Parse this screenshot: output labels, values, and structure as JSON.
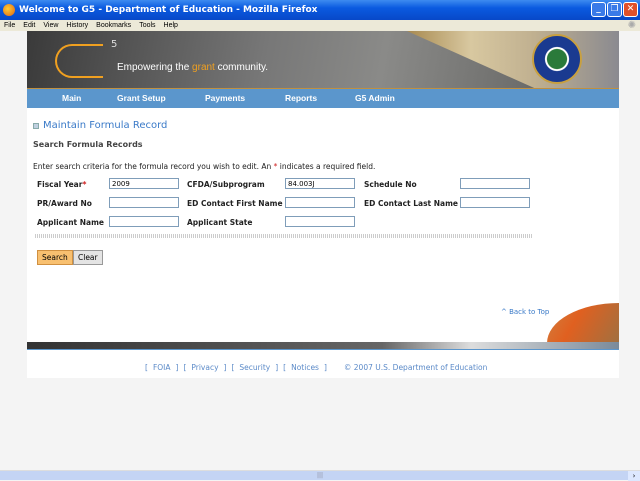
{
  "window": {
    "title": "Welcome to G5 - Department of Education - Mozilla Firefox"
  },
  "menu": [
    "File",
    "Edit",
    "View",
    "History",
    "Bookmarks",
    "Tools",
    "Help"
  ],
  "header": {
    "logo_super": "5",
    "tagline_pre": "Empowering the ",
    "tagline_hl": "grant",
    "tagline_post": " community."
  },
  "nav": [
    "Main",
    "Grant Setup",
    "Payments",
    "Reports",
    "G5 Admin"
  ],
  "page": {
    "title": "Maintain Formula Record",
    "subtitle": "Search Formula Records",
    "instr_pre": "Enter search criteria for the formula record you wish to edit. An ",
    "instr_star": "*",
    "instr_post": " indicates a required field."
  },
  "form": {
    "fiscal_year": {
      "label": "Fiscal Year",
      "star": "*",
      "value": "2009"
    },
    "cfda": {
      "label": "CFDA/Subprogram",
      "value": "84.003J"
    },
    "schedule": {
      "label": "Schedule No",
      "value": ""
    },
    "pr_award": {
      "label": "PR/Award No",
      "value": ""
    },
    "ed_first": {
      "label": "ED Contact First Name",
      "value": ""
    },
    "ed_last": {
      "label": "ED Contact Last Name",
      "value": ""
    },
    "applicant_name": {
      "label": "Applicant Name",
      "value": ""
    },
    "applicant_state": {
      "label": "Applicant State",
      "value": ""
    }
  },
  "buttons": {
    "search": "Search",
    "clear": "Clear"
  },
  "back_to_top": "^ Back to Top",
  "footer": {
    "foia": "FOIA",
    "privacy": "Privacy",
    "security": "Security",
    "notices": "Notices",
    "copyright": "© 2007 U.S. Department of Education"
  },
  "colors": {
    "nav": "#5b96cc",
    "accent": "#f0a020",
    "link": "#3a7ac8"
  }
}
